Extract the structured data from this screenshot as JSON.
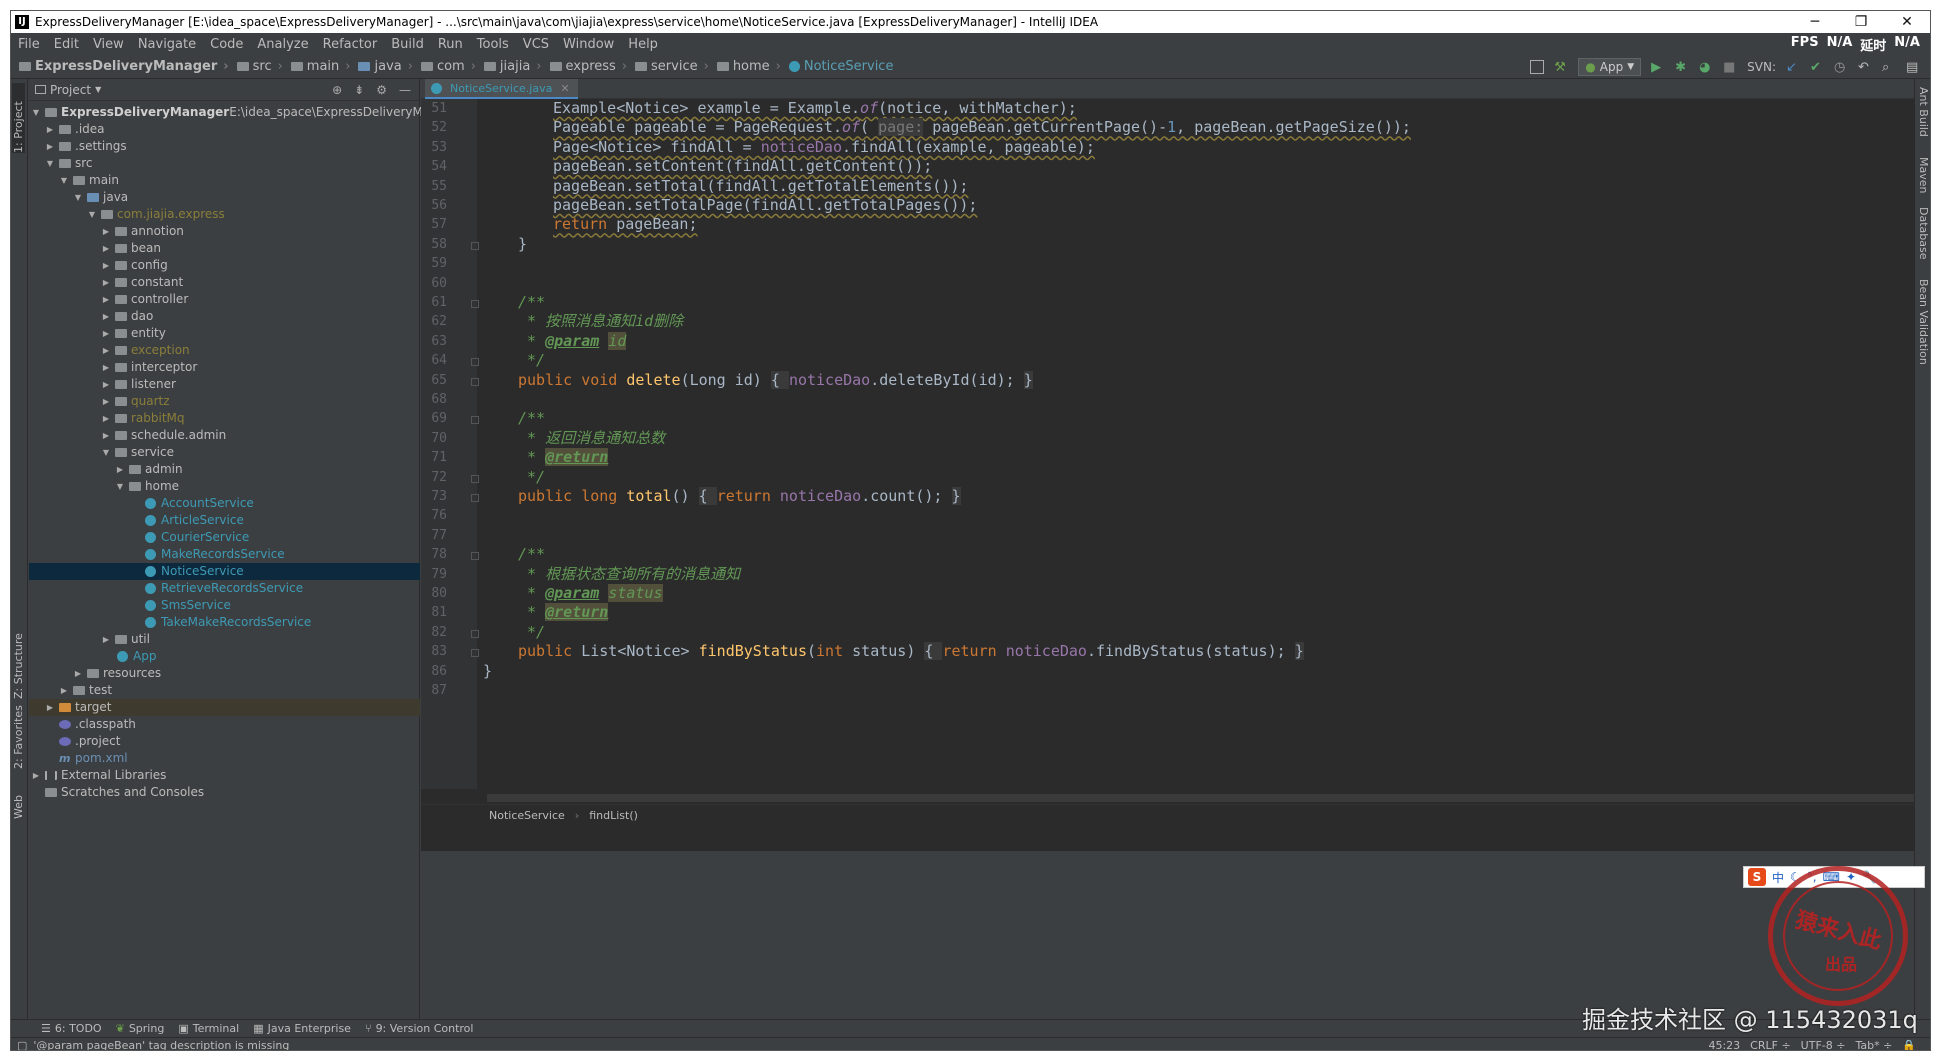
{
  "window": {
    "title": "ExpressDeliveryManager [E:\\idea_space\\ExpressDeliveryManager] - ...\\src\\main\\java\\com\\jiajia\\express\\service\\home\\NoticeService.java [ExpressDeliveryManager] - IntelliJ IDEA",
    "minimize": "─",
    "maximize": "❐",
    "close": "✕"
  },
  "menu": {
    "items": [
      "File",
      "Edit",
      "View",
      "Navigate",
      "Code",
      "Analyze",
      "Refactor",
      "Build",
      "Run",
      "Tools",
      "VCS",
      "Window",
      "Help"
    ],
    "fps": "FPS",
    "fps_val": "N/A",
    "latency": "延时",
    "latency_val": "N/A"
  },
  "nav": {
    "crumbs": [
      "ExpressDeliveryManager",
      "src",
      "main",
      "java",
      "com",
      "jiajia",
      "express",
      "service",
      "home",
      "NoticeService"
    ],
    "run_config": "App",
    "svn": "SVN:"
  },
  "project": {
    "title": "Project",
    "root_name": "ExpressDeliveryManager",
    "root_path": "E:\\idea_space\\ExpressDeliveryManager",
    "tree": [
      ".idea",
      ".settings",
      "src",
      "main",
      "java",
      "com.jiajia.express",
      "annotion",
      "bean",
      "config",
      "constant",
      "controller",
      "dao",
      "entity",
      "exception",
      "interceptor",
      "listener",
      "quartz",
      "rabbitMq",
      "schedule.admin",
      "service",
      "admin",
      "home",
      "AccountService",
      "ArticleService",
      "CourierService",
      "MakeRecordsService",
      "NoticeService",
      "RetrieveRecordsService",
      "SmsService",
      "TakeMakeRecordsService",
      "util",
      "App",
      "resources",
      "test",
      "target",
      ".classpath",
      ".project",
      "pom.xml",
      "External Libraries",
      "Scratches and Consoles"
    ]
  },
  "left_tabs": {
    "project": "1: Project",
    "structure": "Z: Structure",
    "favorites": "2: Favorites",
    "web": "Web"
  },
  "right_tabs": {
    "ant": "Ant Build",
    "maven": "Maven",
    "database": "Database",
    "bean": "Bean Validation"
  },
  "editor": {
    "tab": "NoticeService.java",
    "line_numbers": [
      "51",
      "52",
      "53",
      "54",
      "55",
      "56",
      "57",
      "58",
      "59",
      "60",
      "61",
      "62",
      "63",
      "64",
      "65",
      "68",
      "69",
      "70",
      "71",
      "72",
      "73",
      "76",
      "77",
      "78",
      "79",
      "80",
      "81",
      "82",
      "83",
      "86",
      "87"
    ],
    "code": {
      "l51a": "Example<Notice> example = Example.",
      "l51b": "of",
      "l51c": "(notice, withMatcher);",
      "l52a": "Pageable pageable = PageRequest.",
      "l52b": "of",
      "l52c": "( ",
      "l52hint": "page:",
      "l52d": " pageBean.getCurrentPage()-",
      "l52num": "1",
      "l52e": ", pageBean.getPageSize());",
      "l53a": "Page<Notice> findAll = ",
      "l53fld": "noticeDao",
      "l53b": ".findAll(example, pageable);",
      "l54": "pageBean.setContent(findAll.getContent());",
      "l55": "pageBean.setTotal(findAll.getTotalElements());",
      "l56": "pageBean.setTotalPage(findAll.getTotalPages());",
      "l57kw": "return",
      "l57b": " pageBean;",
      "l58": "}",
      "l61": "/**",
      "l62": " * 按照消息通知id删除",
      "l63a": " * ",
      "l63tag": "@param",
      "l63b": " ",
      "l63id": "id",
      "l64": " */",
      "l65kw1": "public",
      "l65kw2": "void",
      "l65fn": "delete",
      "l65a": "(Long id) ",
      "l65b": "{ ",
      "l65fld": "noticeDao",
      "l65c": ".deleteById(id); ",
      "l65d": "}",
      "l69": "/**",
      "l70": " * 返回消息通知总数",
      "l71a": " * ",
      "l71tag": "@return",
      "l72": " */",
      "l73kw1": "public",
      "l73kw2": "long",
      "l73fn": "total",
      "l73a": "() ",
      "l73b": "{ ",
      "l73kw3": "return",
      "l73fld": "noticeDao",
      "l73c": ".count(); ",
      "l73d": "}",
      "l78": "/**",
      "l79": " * 根据状态查询所有的消息通知",
      "l80a": " * ",
      "l80tag": "@param",
      "l80b": " ",
      "l80id": "status",
      "l81a": " * ",
      "l81tag": "@return",
      "l82": " */",
      "l83kw1": "public",
      "l83a": " List<Notice> ",
      "l83fn": "findByStatus",
      "l83b": "(",
      "l83kw2": "int",
      "l83c": " status) ",
      "l83d": "{ ",
      "l83kw3": "return",
      "l83fld": "noticeDao",
      "l83e": ".findByStatus(status); ",
      "l83f": "}",
      "l86": "}"
    },
    "breadcrumb": [
      "NoticeService",
      "findList()"
    ]
  },
  "toolwindows": [
    "6: TODO",
    "Spring",
    "Terminal",
    "Java Enterprise",
    "9: Version Control"
  ],
  "status": {
    "message": "'@param pageBean' tag description is missing",
    "position": "45:23",
    "line_sep": "CRLF ÷",
    "encoding": "UTF-8 ÷",
    "indent": "Tab* ÷"
  },
  "overlay": {
    "watermark": "掘金技术社区 @ 115432031q",
    "seal_text": "猿来入此",
    "seal_sub": "出品",
    "ime": "中"
  },
  "colors": {
    "keyword": "#cc7832",
    "function": "#ffc66d",
    "field": "#9876aa",
    "comment": "#629755",
    "class_icon": "#3d9ab5"
  }
}
